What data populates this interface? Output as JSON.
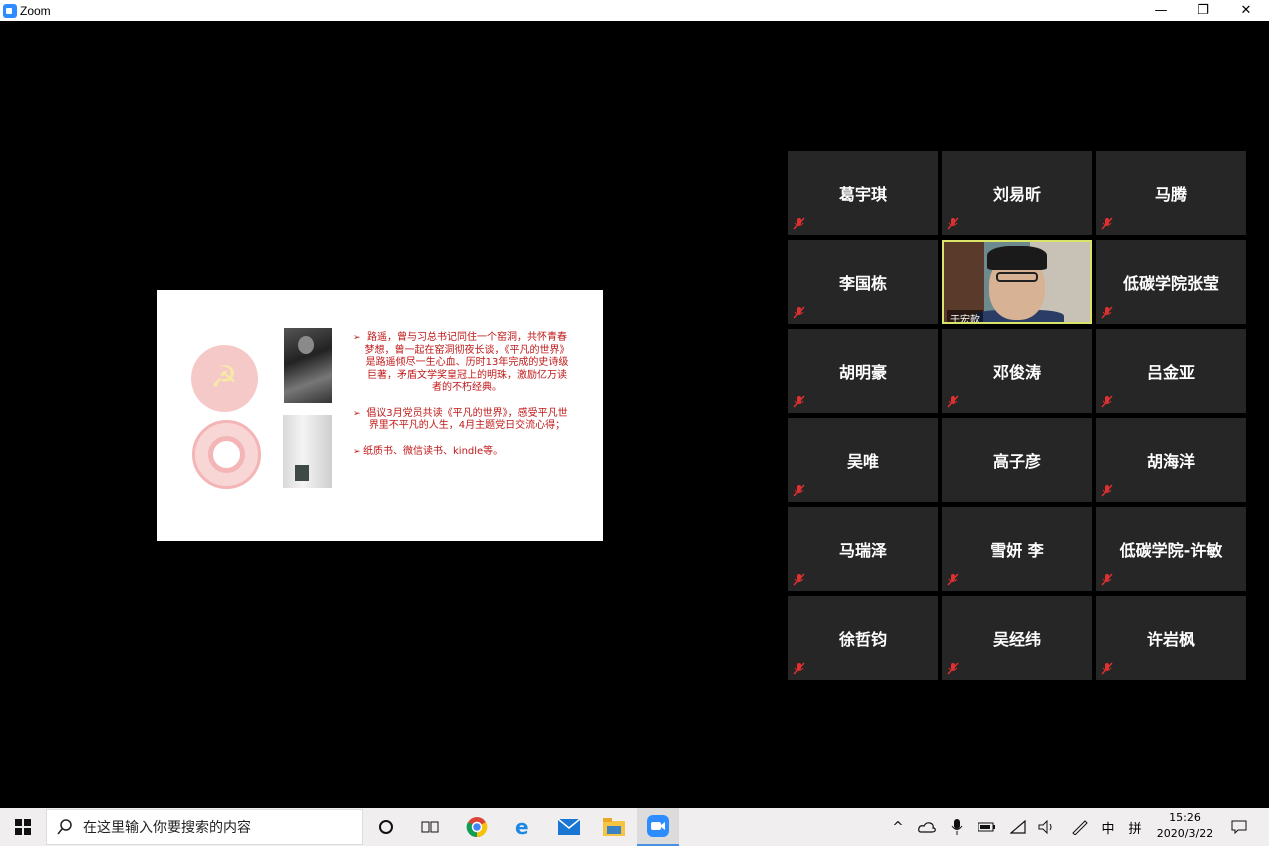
{
  "window": {
    "title": "Zoom",
    "minimize": "—",
    "maximize": "❐",
    "close": "✕"
  },
  "slide": {
    "bullets": [
      "路遥，曾与习总书记同住一个窑洞，共怀青春梦想，曾一起在窑洞彻夜长谈，《平凡的世界》是路遥倾尽一生心血、历时13年完成的史诗级巨著，矛盾文学奖皇冠上的明珠，激励亿万读者的不朽经典。",
      "倡议3月党员共读《平凡的世界》，感受平凡世界里不平凡的人生，4月主题党日交流心得；",
      "纸质书、微信读书、kindle等。"
    ]
  },
  "participants": [
    {
      "name": "葛宇琪",
      "muted": true,
      "video": false
    },
    {
      "name": "刘易昕",
      "muted": true,
      "video": false
    },
    {
      "name": "马腾",
      "muted": true,
      "video": false
    },
    {
      "name": "李国栋",
      "muted": true,
      "video": false
    },
    {
      "name": "于宏款",
      "muted": false,
      "video": true,
      "active_speaker": true
    },
    {
      "name": "低碳学院张莹",
      "muted": true,
      "video": false
    },
    {
      "name": "胡明豪",
      "muted": true,
      "video": false
    },
    {
      "name": "邓俊涛",
      "muted": true,
      "video": false
    },
    {
      "name": "吕金亚",
      "muted": true,
      "video": false
    },
    {
      "name": "吴唯",
      "muted": true,
      "video": false
    },
    {
      "name": "高子彦",
      "muted": false,
      "video": false
    },
    {
      "name": "胡海洋",
      "muted": true,
      "video": false
    },
    {
      "name": "马瑞泽",
      "muted": true,
      "video": false
    },
    {
      "name": "雪妍 李",
      "muted": true,
      "video": false
    },
    {
      "name": "低碳学院-许敏",
      "muted": true,
      "video": false
    },
    {
      "name": "徐哲钧",
      "muted": true,
      "video": false
    },
    {
      "name": "吴经纬",
      "muted": true,
      "video": false
    },
    {
      "name": "许岩枫",
      "muted": true,
      "video": false
    }
  ],
  "taskbar": {
    "search_placeholder": "在这里输入你要搜索的内容",
    "ime_lang": "中",
    "ime_mode": "拼",
    "time": "15:26",
    "date": "2020/3/22"
  },
  "colors": {
    "slide_text": "#c01818",
    "active_speaker_border": "#d9e36a",
    "tile_bg": "#262626",
    "mute_icon": "#e03030"
  }
}
